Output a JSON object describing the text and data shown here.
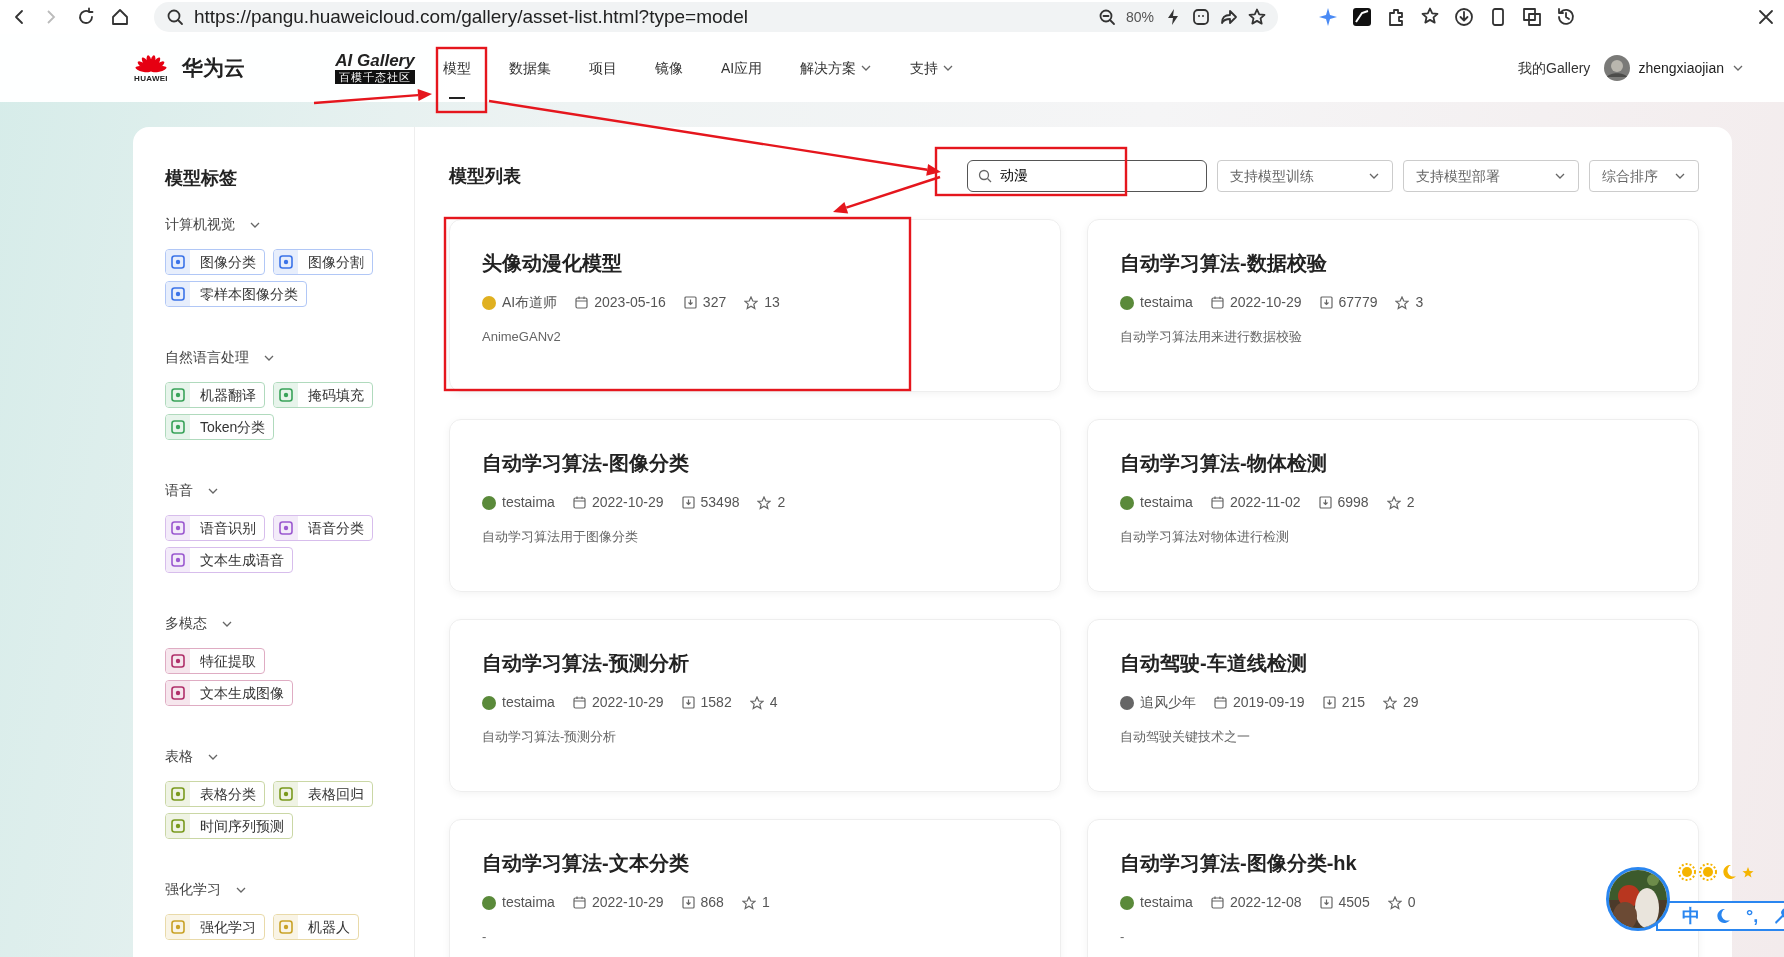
{
  "browser": {
    "url": "https://pangu.huaweicloud.com/gallery/asset-list.html?type=model",
    "zoom": "80%"
  },
  "header": {
    "brand": "华为云",
    "brand_sub": "HUAWEI",
    "gallery_logo": "AI Gallery",
    "gallery_tagline": "百模千态社区",
    "nav": [
      {
        "label": "模型",
        "selected": true,
        "has_menu": false
      },
      {
        "label": "数据集",
        "selected": false,
        "has_menu": false
      },
      {
        "label": "项目",
        "selected": false,
        "has_menu": false
      },
      {
        "label": "镜像",
        "selected": false,
        "has_menu": false
      },
      {
        "label": "AI应用",
        "selected": false,
        "has_menu": false
      },
      {
        "label": "解决方案",
        "selected": false,
        "has_menu": true
      },
      {
        "label": "支持",
        "selected": false,
        "has_menu": true
      }
    ],
    "my_gallery": "我的Gallery",
    "user": "zhengxiaojian"
  },
  "sidebar": {
    "title": "模型标签",
    "groups": [
      {
        "label": "计算机视觉",
        "expanded": true,
        "color": "#3b73e8",
        "tags": [
          "图像分类",
          "图像分割",
          "零样本图像分类"
        ]
      },
      {
        "label": "自然语言处理",
        "expanded": true,
        "color": "#3aa35a",
        "tags": [
          "机器翻译",
          "掩码填充",
          "Token分类"
        ]
      },
      {
        "label": "语音",
        "expanded": true,
        "color": "#9b59d0",
        "tags": [
          "语音识别",
          "语音分类",
          "文本生成语音"
        ]
      },
      {
        "label": "多模态",
        "expanded": true,
        "color": "#b0306a",
        "tags": [
          "特征提取",
          "文本生成图像"
        ]
      },
      {
        "label": "表格",
        "expanded": true,
        "color": "#7a9a1e",
        "tags": [
          "表格分类",
          "表格回归",
          "时间序列预测"
        ]
      },
      {
        "label": "强化学习",
        "expanded": true,
        "color": "#c9a227",
        "tags": [
          "强化学习",
          "机器人"
        ]
      }
    ]
  },
  "list": {
    "title": "模型列表",
    "search": {
      "value": "动漫"
    },
    "filters": [
      {
        "label": "支持模型训练"
      },
      {
        "label": "支持模型部署"
      },
      {
        "label": "综合排序"
      }
    ],
    "cards": [
      {
        "title": "头像动漫化模型",
        "author": "AI布道师",
        "color": "#e0b020",
        "date": "2023-05-16",
        "downloads": "327",
        "favorites": "13",
        "description": "AnimeGANv2"
      },
      {
        "title": "自动学习算法-数据校验",
        "author": "testaima",
        "color": "#5a8a3a",
        "date": "2022-10-29",
        "downloads": "67779",
        "favorites": "3",
        "description": "自动学习算法用来进行数据校验"
      },
      {
        "title": "自动学习算法-图像分类",
        "author": "testaima",
        "color": "#5a8a3a",
        "date": "2022-10-29",
        "downloads": "53498",
        "favorites": "2",
        "description": "自动学习算法用于图像分类"
      },
      {
        "title": "自动学习算法-物体检测",
        "author": "testaima",
        "color": "#5a8a3a",
        "date": "2022-11-02",
        "downloads": "6998",
        "favorites": "2",
        "description": "自动学习算法对物体进行检测"
      },
      {
        "title": "自动学习算法-预测分析",
        "author": "testaima",
        "color": "#5a8a3a",
        "date": "2022-10-29",
        "downloads": "1582",
        "favorites": "4",
        "description": "自动学习算法-预测分析"
      },
      {
        "title": "自动驾驶-车道线检测",
        "author": "追风少年",
        "color": "#666666",
        "date": "2019-09-19",
        "downloads": "215",
        "favorites": "29",
        "description": "自动驾驶关键技术之一"
      },
      {
        "title": "自动学习算法-文本分类",
        "author": "testaima",
        "color": "#5a8a3a",
        "date": "2022-10-29",
        "downloads": "868",
        "favorites": "1",
        "description": "-"
      },
      {
        "title": "自动学习算法-图像分类-hk",
        "author": "testaima",
        "color": "#5a8a3a",
        "date": "2022-12-08",
        "downloads": "4505",
        "favorites": "0",
        "description": "-"
      }
    ]
  },
  "ime": {
    "mode": "中",
    "punct": "°,"
  }
}
